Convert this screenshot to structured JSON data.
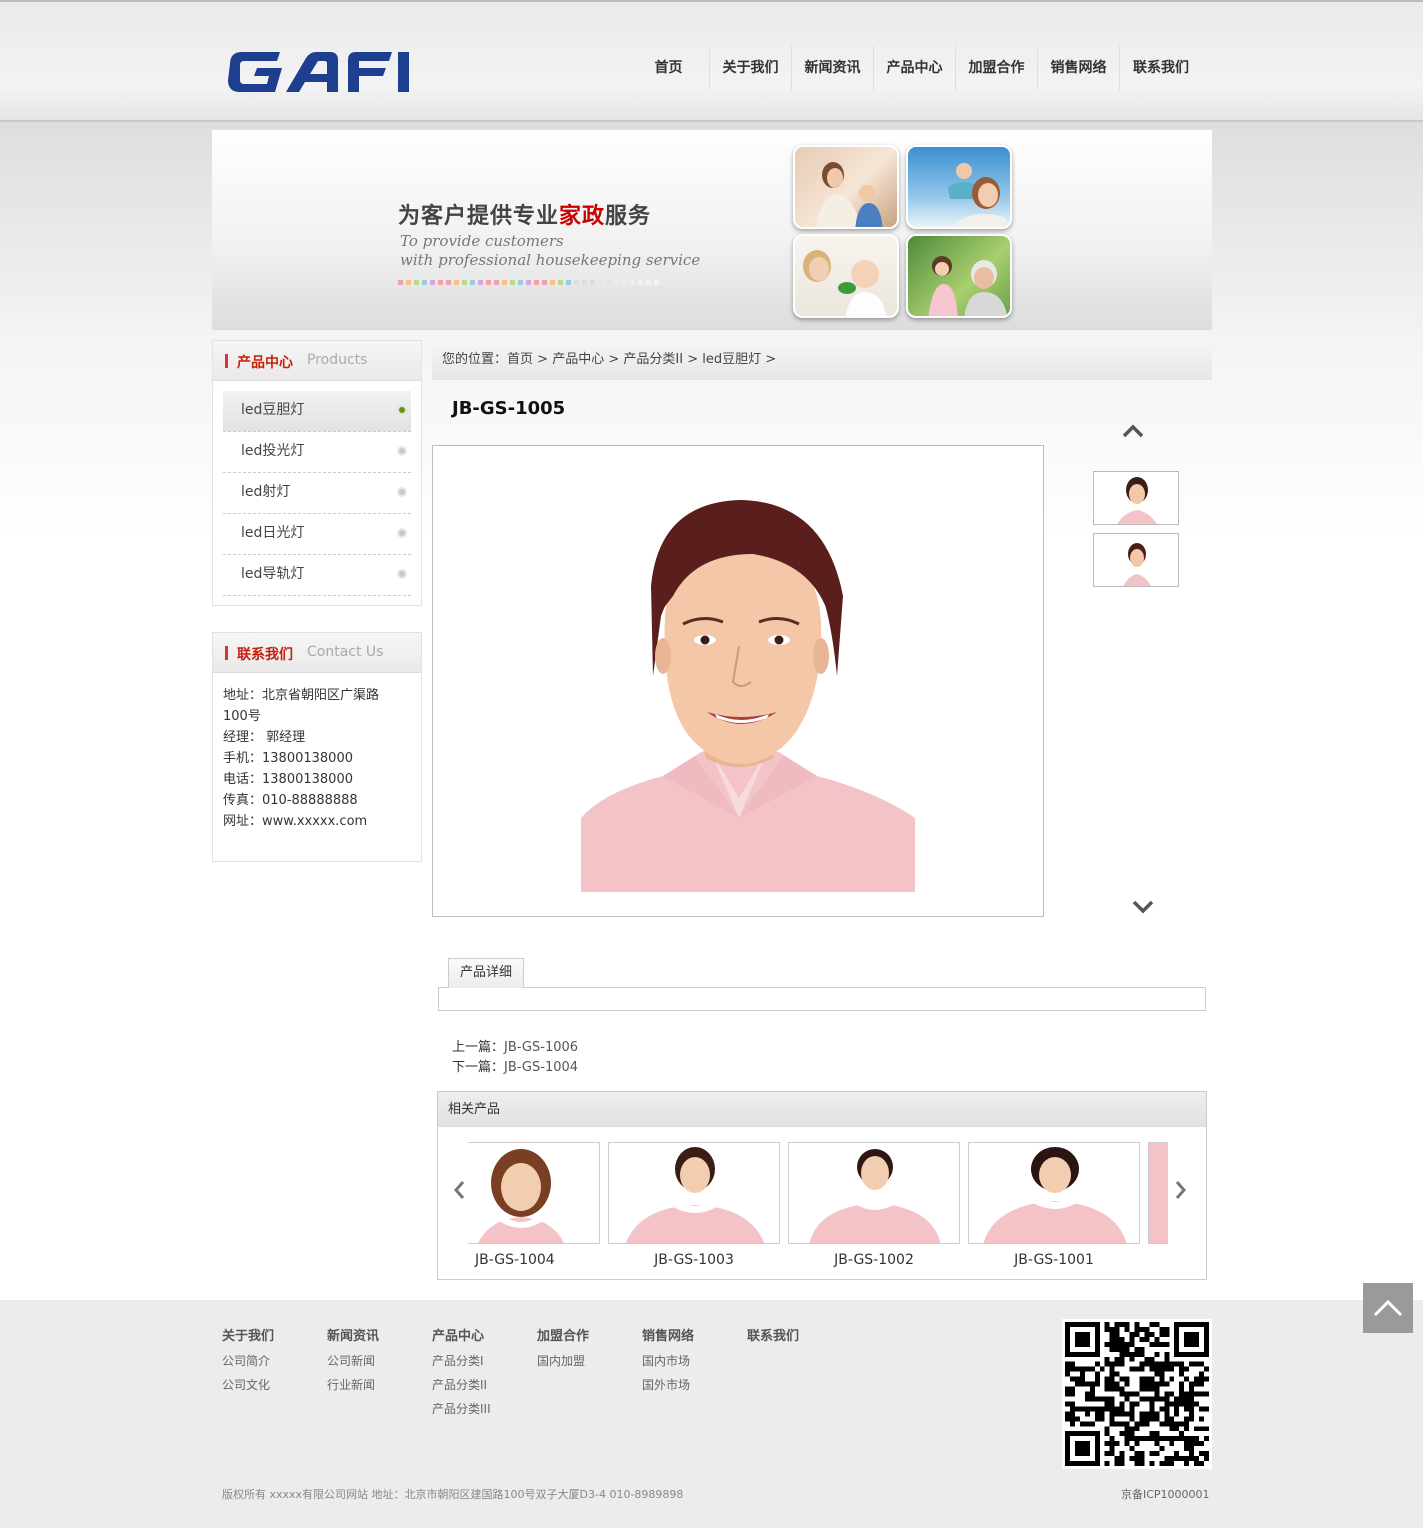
{
  "header": {
    "logo_text": "GAFI",
    "nav": [
      "首页",
      "关于我们",
      "新闻资讯",
      "产品中心",
      "加盟合作",
      "销售网络",
      "联系我们"
    ]
  },
  "banner": {
    "title_before": "为客户提供专业",
    "title_highlight": "家政",
    "title_after": "服务",
    "en_line1": "To provide customers",
    "en_line2": "with professional housekeeping service"
  },
  "sidebar": {
    "products": {
      "title": "产品中心",
      "subtitle": "Products",
      "items": [
        "led豆胆灯",
        "led投光灯",
        "led射灯",
        "led日光灯",
        "led导轨灯"
      ],
      "active_index": 0
    },
    "contact": {
      "title": "联系我们",
      "subtitle": "Contact Us",
      "address_line1": "地址：北京省朝阳区广渠路",
      "address_line2": "100号",
      "manager": "经理： 郭经理",
      "mobile": "手机：13800138000",
      "phone": "电话：13800138000",
      "fax": "传真：010-88888888",
      "website": "网址：www.xxxxx.com"
    }
  },
  "breadcrumb": {
    "prefix": "您的位置：",
    "items": [
      "首页",
      "产品中心",
      "产品分类II",
      "led豆胆灯"
    ],
    "separator": ">"
  },
  "product": {
    "title": "JB-GS-1005",
    "tab_label": "产品详细",
    "prev_label": "上一篇：",
    "prev_value": "JB-GS-1006",
    "next_label": "下一篇：",
    "next_value": "JB-GS-1004"
  },
  "related": {
    "title": "相关产品",
    "items": [
      "JB-GS-1004",
      "JB-GS-1003",
      "JB-GS-1002",
      "JB-GS-1001"
    ]
  },
  "footer": {
    "columns": [
      {
        "title": "关于我们",
        "links": [
          "公司简介",
          "公司文化"
        ]
      },
      {
        "title": "新闻资讯",
        "links": [
          "公司新闻",
          "行业新闻"
        ]
      },
      {
        "title": "产品中心",
        "links": [
          "产品分类I",
          "产品分类II",
          "产品分类III"
        ]
      },
      {
        "title": "加盟合作",
        "links": [
          "国内加盟"
        ]
      },
      {
        "title": "销售网络",
        "links": [
          "国内市场",
          "国外市场"
        ]
      },
      {
        "title": "联系我们",
        "links": []
      }
    ],
    "copyright": "版权所有 xxxxx有限公司网站 地址：北京市朝阳区建国路100号双子大厦D3-4 010-8989898",
    "icp": "京备ICP1000001"
  },
  "colors": {
    "logo_blue": "#1e3f8f",
    "accent_red": "#c81e0a",
    "active_dot": "#6a8f1a",
    "uniform_pink": "#f3c3c8"
  }
}
